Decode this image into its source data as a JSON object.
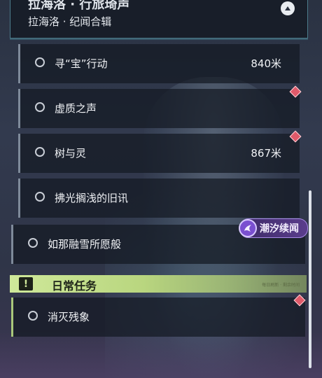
{
  "header": {
    "title": "拉海洛 · 行旅琦声",
    "subtitle": "拉海洛 · 纪闻合辑"
  },
  "quests": [
    {
      "label": "寻“宝”行动",
      "distance": "840米"
    },
    {
      "label": "虚质之声",
      "distance": ""
    },
    {
      "label": "树与灵",
      "distance": "867米"
    },
    {
      "label": "拂光搁浅的旧讯",
      "distance": ""
    },
    {
      "label": "如那融雪所愿般",
      "distance": ""
    }
  ],
  "badge": {
    "label": "潮汐续闻"
  },
  "daily": {
    "label": "日常任务",
    "icon": "!",
    "tiny": "每日刷新 · 剩余时间"
  },
  "daily_quests": [
    {
      "label": "消灭残象"
    }
  ],
  "colors": {
    "accent_cyan": "#78c8dc",
    "daily_green": "#cfe89a",
    "marker_red": "#e05a6a",
    "badge_purple": "#5a3d8c"
  }
}
